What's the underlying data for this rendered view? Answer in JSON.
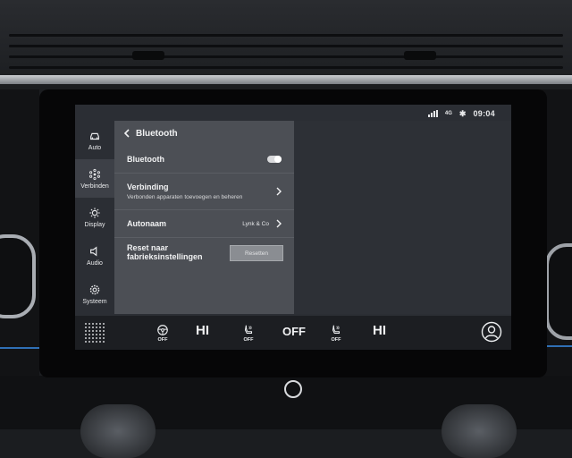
{
  "status": {
    "time": "09:04",
    "network": "4G"
  },
  "nav": [
    {
      "label": "Auto",
      "icon": "car-icon",
      "active": false
    },
    {
      "label": "Verbinden",
      "icon": "connect-icon",
      "active": true
    },
    {
      "label": "Display",
      "icon": "brightness-icon",
      "active": false
    },
    {
      "label": "Audio",
      "icon": "speaker-icon",
      "active": false
    },
    {
      "label": "Systeem",
      "icon": "gear-icon",
      "active": false
    }
  ],
  "panel": {
    "title": "Bluetooth",
    "bluetooth_label": "Bluetooth",
    "bluetooth_on": true,
    "connection_label": "Verbinding",
    "connection_sub": "Verbonden apparaten toevoegen en beheren",
    "carname_label": "Autonaam",
    "carname_value": "Lynk & Co",
    "reset_label_1": "Reset naar",
    "reset_label_2": "fabrieksinstellingen",
    "reset_button": "Resetten"
  },
  "climate": {
    "left_wheel_heat": "OFF",
    "left_temp": "HI",
    "left_seat_heat": "OFF",
    "fan": "OFF",
    "right_seat_heat": "OFF",
    "right_temp": "HI"
  }
}
